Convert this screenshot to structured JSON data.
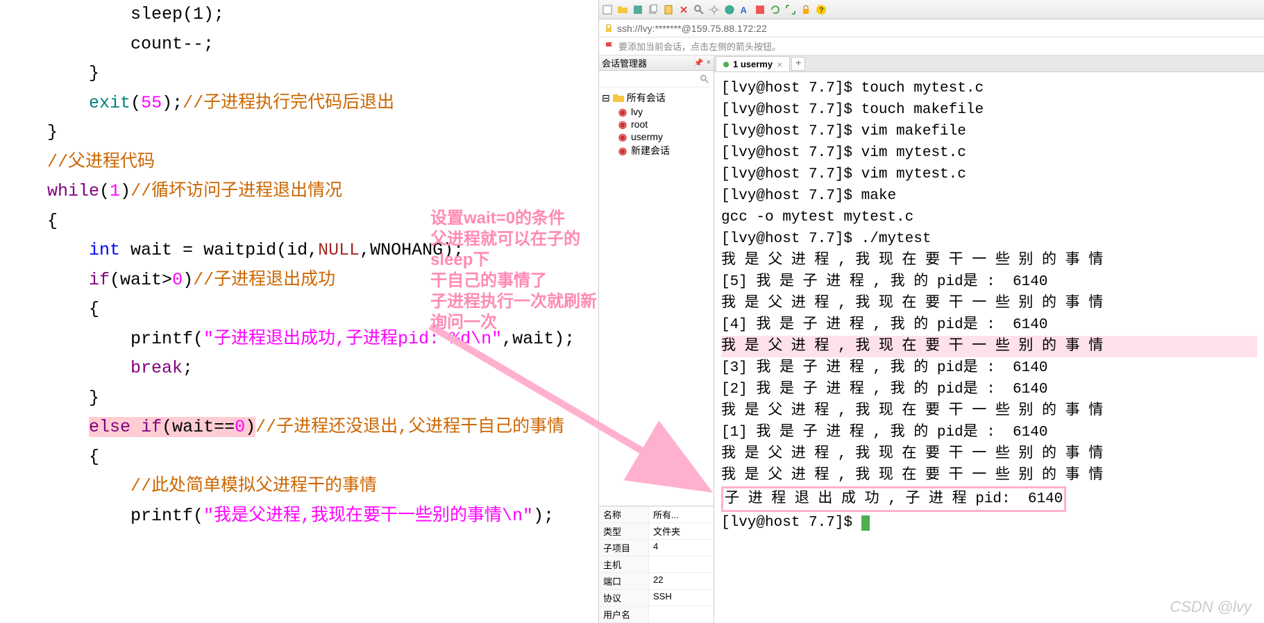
{
  "code": {
    "l1": "            sleep(1);",
    "l2": "            count--;",
    "l3": "        }",
    "l4a": "        exit(55);",
    "l4b": "//子进程执行完代码后退出",
    "l5": "    }",
    "l6": "    //父进程代码",
    "l7a": "    while(1)",
    "l7b": "//循坏访问子进程退出情况",
    "l8": "    {",
    "l9a": "        int wait = waitpid(id,NULL,WNOHANG);",
    "l10a": "        if(wait>0)",
    "l10b": "//子进程退出成功",
    "l11": "        {",
    "l12a": "            printf(",
    "l12b": "\"子进程退出成功,子进程pid: %d\\n\"",
    "l12c": ",wait);",
    "l13": "            break;",
    "l14": "        }",
    "l15a": "        else if(wait==0)",
    "l15b": "//子进程还没退出,父进程干自己的事情",
    "l16": "        {",
    "l17": "            //此处简单模拟父进程干的事情",
    "l18a": "            printf(",
    "l18b": "\"我是父进程,我现在要干一些别的事情\\n\"",
    "l18c": ");"
  },
  "annotation": {
    "l1": "设置wait=0的条件",
    "l2": "父进程就可以在子的sleep下",
    "l3": "干自己的事情了",
    "l4": "子进程执行一次就刷新询问一次"
  },
  "addr": "ssh://lvy:*******@159.75.88.172:22",
  "hint": "要添加当前会话，点击左侧的箭头按钮。",
  "sidebar": {
    "title": "会话管理器",
    "pin": "📌",
    "close": "×",
    "root": "所有会话",
    "items": [
      "lvy",
      "root",
      "usermy",
      "新建会话"
    ]
  },
  "props": {
    "r0k": "名称",
    "r0v": "所有...",
    "r1k": "类型",
    "r1v": "文件夹",
    "r2k": "子项目",
    "r2v": "4",
    "r3k": "主机",
    "r3v": "",
    "r4k": "端口",
    "r4v": "22",
    "r5k": "协议",
    "r5v": "SSH",
    "r6k": "用户名",
    "r6v": ""
  },
  "tab": {
    "label": "1 usermy",
    "dot_color": "#4caf50"
  },
  "term": {
    "l1": "[lvy@host 7.7]$ touch mytest.c",
    "l2": "[lvy@host 7.7]$ touch makefile",
    "l3": "[lvy@host 7.7]$ vim makefile",
    "l4": "[lvy@host 7.7]$ vim mytest.c",
    "l5": "[lvy@host 7.7]$ vim mytest.c",
    "l6": "[lvy@host 7.7]$ make",
    "l7": "gcc -o mytest mytest.c",
    "l8": "[lvy@host 7.7]$ ./mytest",
    "l9": "我 是 父 进 程 , 我 现 在 要 干 一 些 别 的 事 情",
    "l10": "[5] 我 是 子 进 程 , 我 的 pid是 :  6140",
    "l11": "我 是 父 进 程 , 我 现 在 要 干 一 些 别 的 事 情",
    "l12": "[4] 我 是 子 进 程 , 我 的 pid是 :  6140",
    "l13": "我 是 父 进 程 , 我 现 在 要 干 一 些 别 的 事 情",
    "l14": "[3] 我 是 子 进 程 , 我 的 pid是 :  6140",
    "l15": "[2] 我 是 子 进 程 , 我 的 pid是 :  6140",
    "l16": "我 是 父 进 程 , 我 现 在 要 干 一 些 别 的 事 情",
    "l17": "[1] 我 是 子 进 程 , 我 的 pid是 :  6140",
    "l18": "我 是 父 进 程 , 我 现 在 要 干 一 些 别 的 事 情",
    "l19": "我 是 父 进 程 , 我 现 在 要 干 一 些 别 的 事 情",
    "l20": "子 进 程 退 出 成 功 , 子 进 程 pid:  6140",
    "l21": "[lvy@host 7.7]$ "
  },
  "watermark": "CSDN @lvy"
}
